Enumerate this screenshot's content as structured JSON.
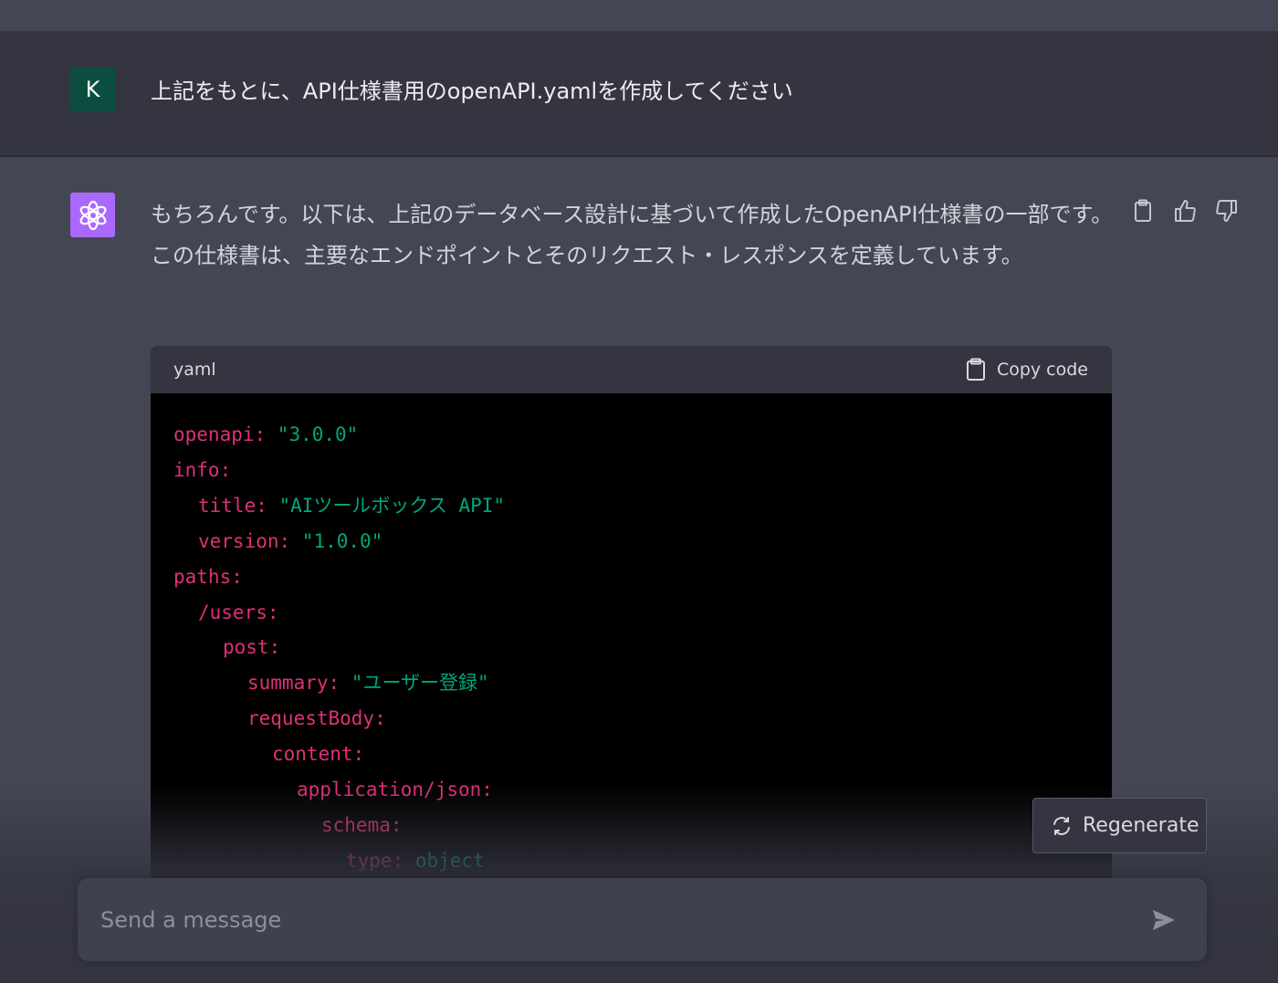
{
  "user_message": {
    "avatar_letter": "K",
    "text": "上記をもとに、API仕様書用のopenAPI.yamlを作成してください"
  },
  "assistant_message": {
    "avatar_icon": "openai-logo-icon",
    "text": "もちろんです。以下は、上記のデータベース設計に基づいて作成したOpenAPI仕様書の一部です。この仕様書は、主要なエンドポイントとそのリクエスト・レスポンスを定義しています。",
    "actions": [
      "clipboard-icon",
      "thumbs-up-icon",
      "thumbs-down-icon"
    ]
  },
  "code_block": {
    "language": "yaml",
    "copy_label": "Copy code",
    "lines": [
      {
        "indent": "",
        "key": "openapi:",
        "value": " \"3.0.0\""
      },
      {
        "indent": "",
        "key": "info:",
        "value": ""
      },
      {
        "indent": "  ",
        "key": "title:",
        "value": " \"AIツールボックス API\""
      },
      {
        "indent": "  ",
        "key": "version:",
        "value": " \"1.0.0\""
      },
      {
        "indent": "",
        "key": "paths:",
        "value": ""
      },
      {
        "indent": "  ",
        "key": "/users:",
        "value": ""
      },
      {
        "indent": "    ",
        "key": "post:",
        "value": ""
      },
      {
        "indent": "      ",
        "key": "summary:",
        "value": " \"ユーザー登録\""
      },
      {
        "indent": "      ",
        "key": "requestBody:",
        "value": ""
      },
      {
        "indent": "        ",
        "key": "content:",
        "value": ""
      },
      {
        "indent": "          ",
        "key": "application/json:",
        "value": ""
      },
      {
        "indent": "            ",
        "key": "schema:",
        "value": ""
      },
      {
        "indent": "              ",
        "key": "type:",
        "value": " object"
      }
    ]
  },
  "regenerate_label": "Regenerate",
  "composer": {
    "placeholder": "Send a message",
    "send_icon": "send-icon"
  },
  "colors": {
    "user_bg": "#343541",
    "assistant_bg": "#444654",
    "code_key": "#df3079",
    "code_string": "#00a67d",
    "user_avatar": "#0b4e3f",
    "assistant_avatar": "#ab68ff"
  }
}
